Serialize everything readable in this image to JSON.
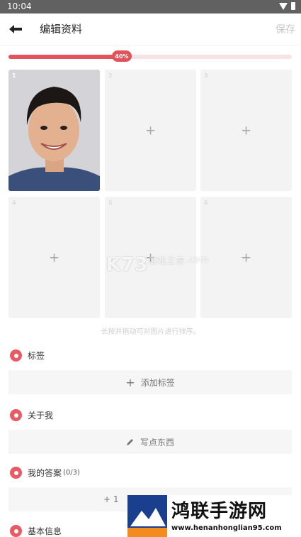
{
  "status_bar": {
    "time": "10:04"
  },
  "header": {
    "title": "编辑资料",
    "save_label": "保存"
  },
  "progress": {
    "percent": 40,
    "label": "40%"
  },
  "photos": [
    {
      "index": "1",
      "filled": true
    },
    {
      "index": "2",
      "filled": false,
      "add": "+"
    },
    {
      "index": "3",
      "filled": false,
      "add": "+"
    },
    {
      "index": "4",
      "filled": false,
      "add": "+"
    },
    {
      "index": "5",
      "filled": false,
      "add": "+"
    },
    {
      "index": "6",
      "filled": false,
      "add": "+"
    }
  ],
  "hint": "长按并拖动可对图片进行排序。",
  "sections": {
    "tags": {
      "title": "标签",
      "action": "添加标签",
      "action_icon": "plus-icon"
    },
    "about": {
      "title": "关于我",
      "action": "写点东西",
      "action_icon": "pencil-icon"
    },
    "answers": {
      "title": "我的答案",
      "count": "(0/3)",
      "action_prefix": "+ 1"
    },
    "basic": {
      "title": "基本信息"
    }
  },
  "watermark": {
    "brand": "K73",
    "sub": "游戏之家",
    "domain": ".com"
  },
  "ad": {
    "title": "鸿联手游网",
    "url": "www.henanhonglian95.com"
  },
  "colors": {
    "accent": "#e2545c",
    "slot_bg": "#f3f3f3",
    "status_bar": "#616161"
  }
}
